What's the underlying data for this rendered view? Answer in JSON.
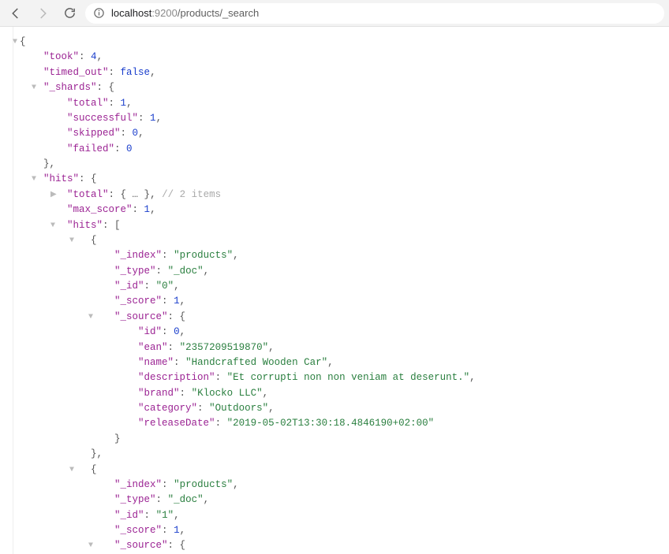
{
  "toolbar": {
    "url_host": "localhost",
    "url_port": ":9200",
    "url_path": "/products/_search"
  },
  "json": {
    "took": 4,
    "timed_out": false,
    "_shards": {
      "total": 1,
      "successful": 1,
      "skipped": 0,
      "failed": 0
    },
    "hits": {
      "total_collapsed": "{ … }",
      "total_comment": " // 2 items",
      "max_score": 1,
      "hits": [
        {
          "_index": "products",
          "_type": "_doc",
          "_id": "0",
          "_score": 1,
          "_source": {
            "id": 0,
            "ean": "2357209519870",
            "name": "Handcrafted Wooden Car",
            "description": "Et corrupti non non veniam at deserunt.",
            "brand": "Klocko LLC",
            "category": "Outdoors",
            "releaseDate": "2019-05-02T13:30:18.4846190+02:00"
          }
        },
        {
          "_index": "products",
          "_type": "_doc",
          "_id": "1",
          "_score": 1,
          "_source": {}
        }
      ]
    }
  }
}
